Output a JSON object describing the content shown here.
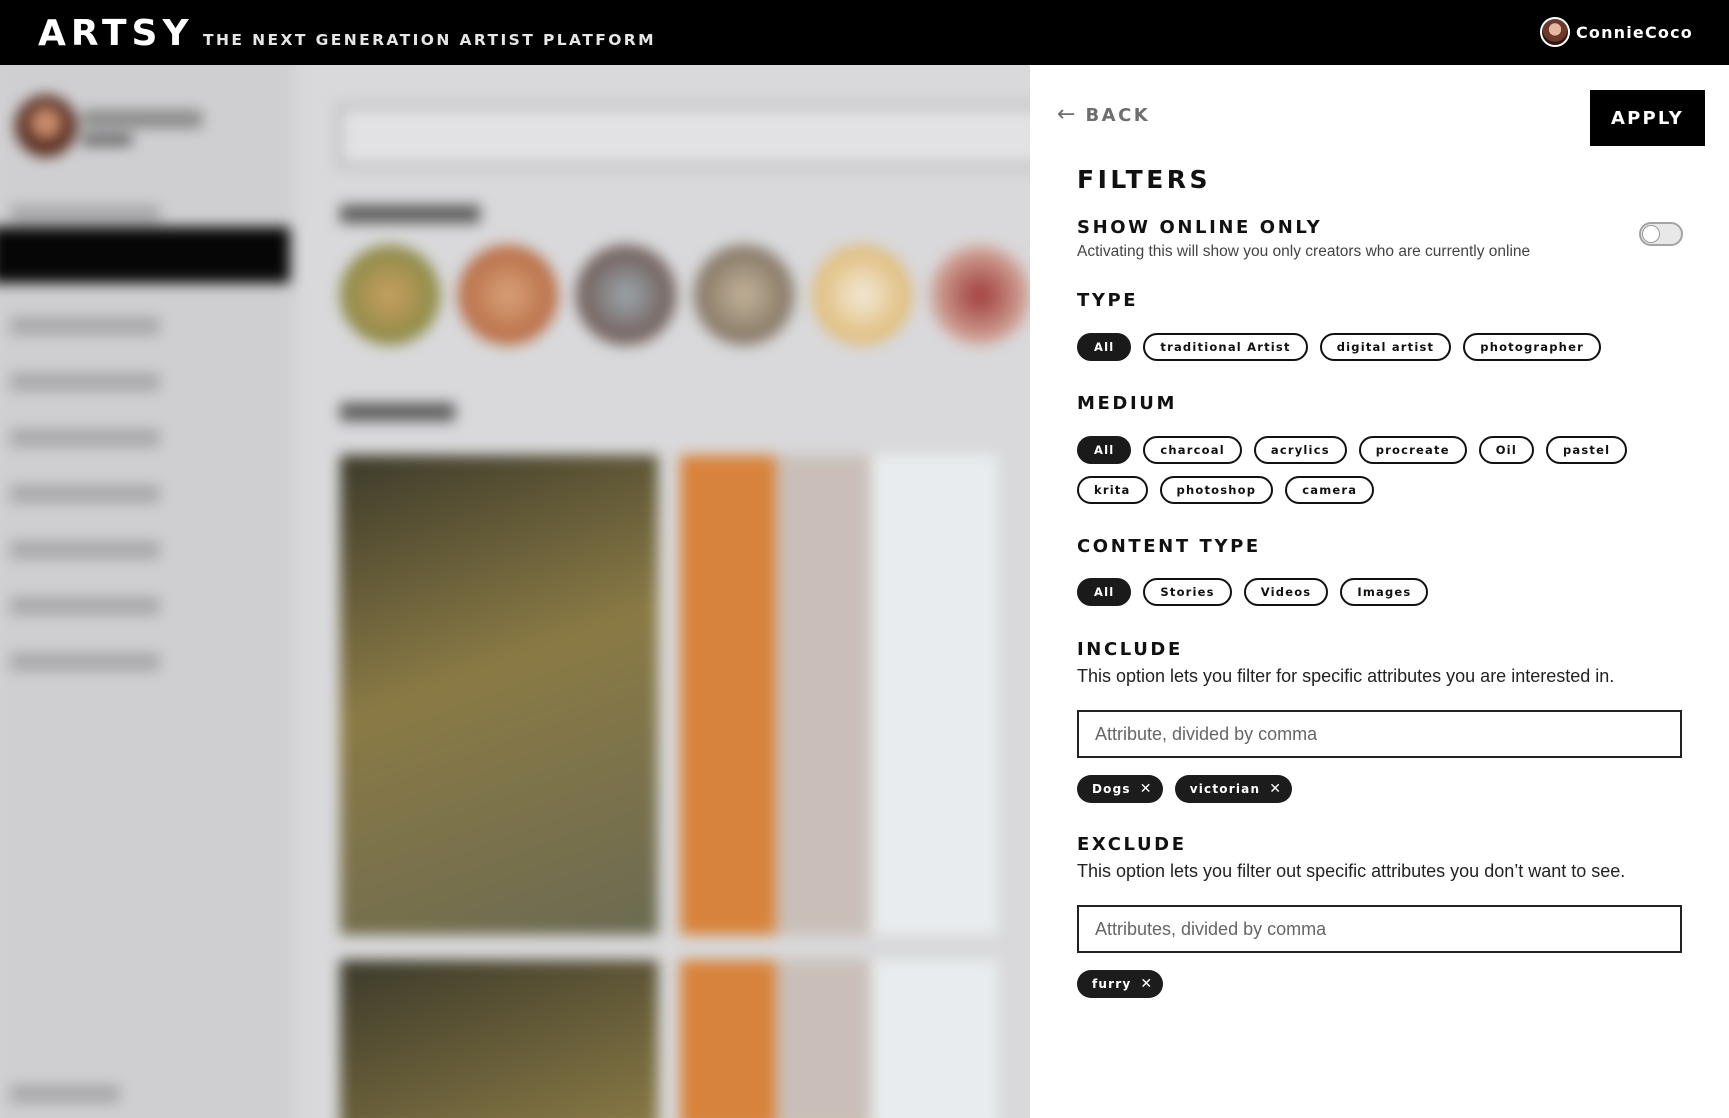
{
  "header": {
    "logo": "ARTSY",
    "tagline": "THE NEXT GENERATION ARTIST PLATFORM",
    "username": "ConnieCoco"
  },
  "filters_panel": {
    "back_label": "BACK",
    "apply_label": "APPLY",
    "title": "FILTERS",
    "online_only": {
      "heading": "SHOW ONLINE ONLY",
      "description": "Activating this will show you only creators who are currently online",
      "enabled": false
    },
    "type": {
      "heading": "TYPE",
      "options": [
        "All",
        "traditional Artist",
        "digital artist",
        "photographer"
      ],
      "selected": "All"
    },
    "medium": {
      "heading": "MEDIUM",
      "options": [
        "All",
        "charcoal",
        "acrylics",
        "procreate",
        "Oil",
        "pastel",
        "krita",
        "photoshop",
        "camera"
      ],
      "selected": "All"
    },
    "content_type": {
      "heading": "CONTENT TYPE",
      "options": [
        "All",
        "Stories",
        "Videos",
        "Images"
      ],
      "selected": "All"
    },
    "include": {
      "heading": "INCLUDE",
      "description": "This option lets you filter for specific attributes you are interested in.",
      "placeholder": "Attribute, divided by comma",
      "tags": [
        "Dogs",
        "victorian"
      ]
    },
    "exclude": {
      "heading": "EXCLUDE",
      "description": "This option lets you filter out specific attributes you don’t want to see.",
      "placeholder": "Attributes, divided by comma",
      "tags": [
        "furry"
      ]
    }
  },
  "icons": {
    "back": "arrow-left-icon",
    "remove_tag": "close-icon",
    "avatar": "avatar"
  },
  "colors": {
    "topbar": "#000000",
    "chip_active": "#1a1a1a",
    "panel_bg": "#ffffff",
    "backdrop": "#d9d9db"
  }
}
